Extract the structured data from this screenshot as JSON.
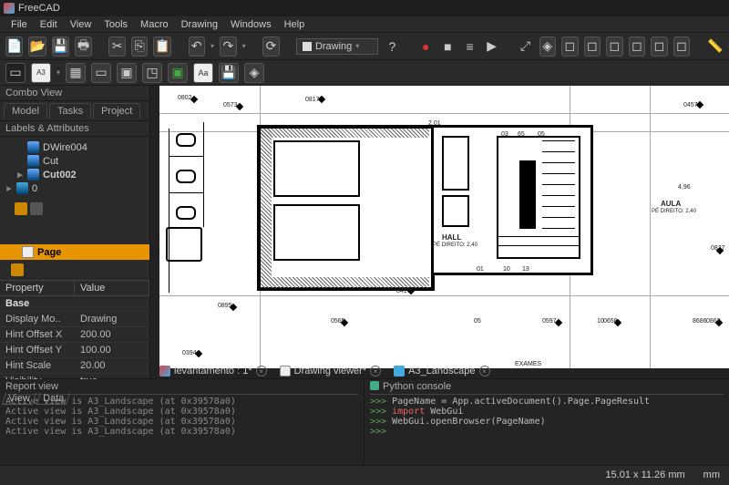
{
  "app": {
    "title": "FreeCAD"
  },
  "menu": [
    "File",
    "Edit",
    "View",
    "Tools",
    "Macro",
    "Drawing",
    "Windows",
    "Help"
  ],
  "workbench": {
    "selected": "Drawing"
  },
  "combo": {
    "title": "Combo View",
    "tabs": [
      "Model",
      "Tasks",
      "Project"
    ],
    "tree_header": "Labels & Attributes",
    "items": [
      {
        "label": "DWire004",
        "icon": "part"
      },
      {
        "label": "Cut",
        "icon": "part"
      },
      {
        "label": "Cut002",
        "icon": "part",
        "bold": true
      },
      {
        "label": "0",
        "icon": "folder",
        "expand": true
      },
      {
        "label": "Page",
        "icon": "page",
        "selected": true
      }
    ],
    "prop_header": [
      "Property",
      "Value"
    ],
    "prop_group": "Base",
    "props": [
      {
        "k": "Display Mo..",
        "v": "Drawing"
      },
      {
        "k": "Hint Offset X",
        "v": "200.00"
      },
      {
        "k": "Hint Offset Y",
        "v": "100.00"
      },
      {
        "k": "Hint Scale",
        "v": "20.00"
      },
      {
        "k": "Visibility",
        "v": "true"
      }
    ],
    "bottom_tabs": [
      "View",
      "Data"
    ]
  },
  "doc_tabs": [
    {
      "label": "levantamento : 1*",
      "icon": "app"
    },
    {
      "label": "Drawing viewer*",
      "icon": "page"
    },
    {
      "label": "A3_Landscape",
      "icon": "web"
    }
  ],
  "drawing": {
    "labels": {
      "hall": "HALL",
      "hall_sub": "PÉ DIREITO: 2,40",
      "aula": "AULA",
      "aula_sub": "PÉ DIREITO: 2,40",
      "examiner": "EXAMES"
    },
    "dims": [
      "0802",
      "0573",
      "0817",
      "0457",
      "0877",
      "0863",
      "4,96",
      "2,01",
      "0417",
      "03",
      "65",
      "05",
      "10",
      "13",
      "0565",
      "05",
      "0597",
      "10",
      "01",
      "0394",
      "0895",
      "0658",
      "8686"
    ]
  },
  "report": {
    "title": "Report view",
    "lines": [
      "Active view is A3_Landscape (at 0x39578a0)",
      "Active view is A3_Landscape (at 0x39578a0)",
      "Active view is A3_Landscape (at 0x39578a0)",
      "Active view is A3_Landscape (at 0x39578a0)"
    ]
  },
  "pyconsole": {
    "title": "Python console",
    "lines": [
      {
        "prompt": ">>>",
        "code": "PageName = App.activeDocument().Page.PageResult"
      },
      {
        "prompt": ">>>",
        "code": "import WebGui",
        "import": true
      },
      {
        "prompt": ">>>",
        "code": "WebGui.openBrowser(PageName)"
      },
      {
        "prompt": ">>>",
        "code": ""
      }
    ]
  },
  "status": {
    "coords": "15.01 x 11.26 mm",
    "unit": "mm"
  }
}
